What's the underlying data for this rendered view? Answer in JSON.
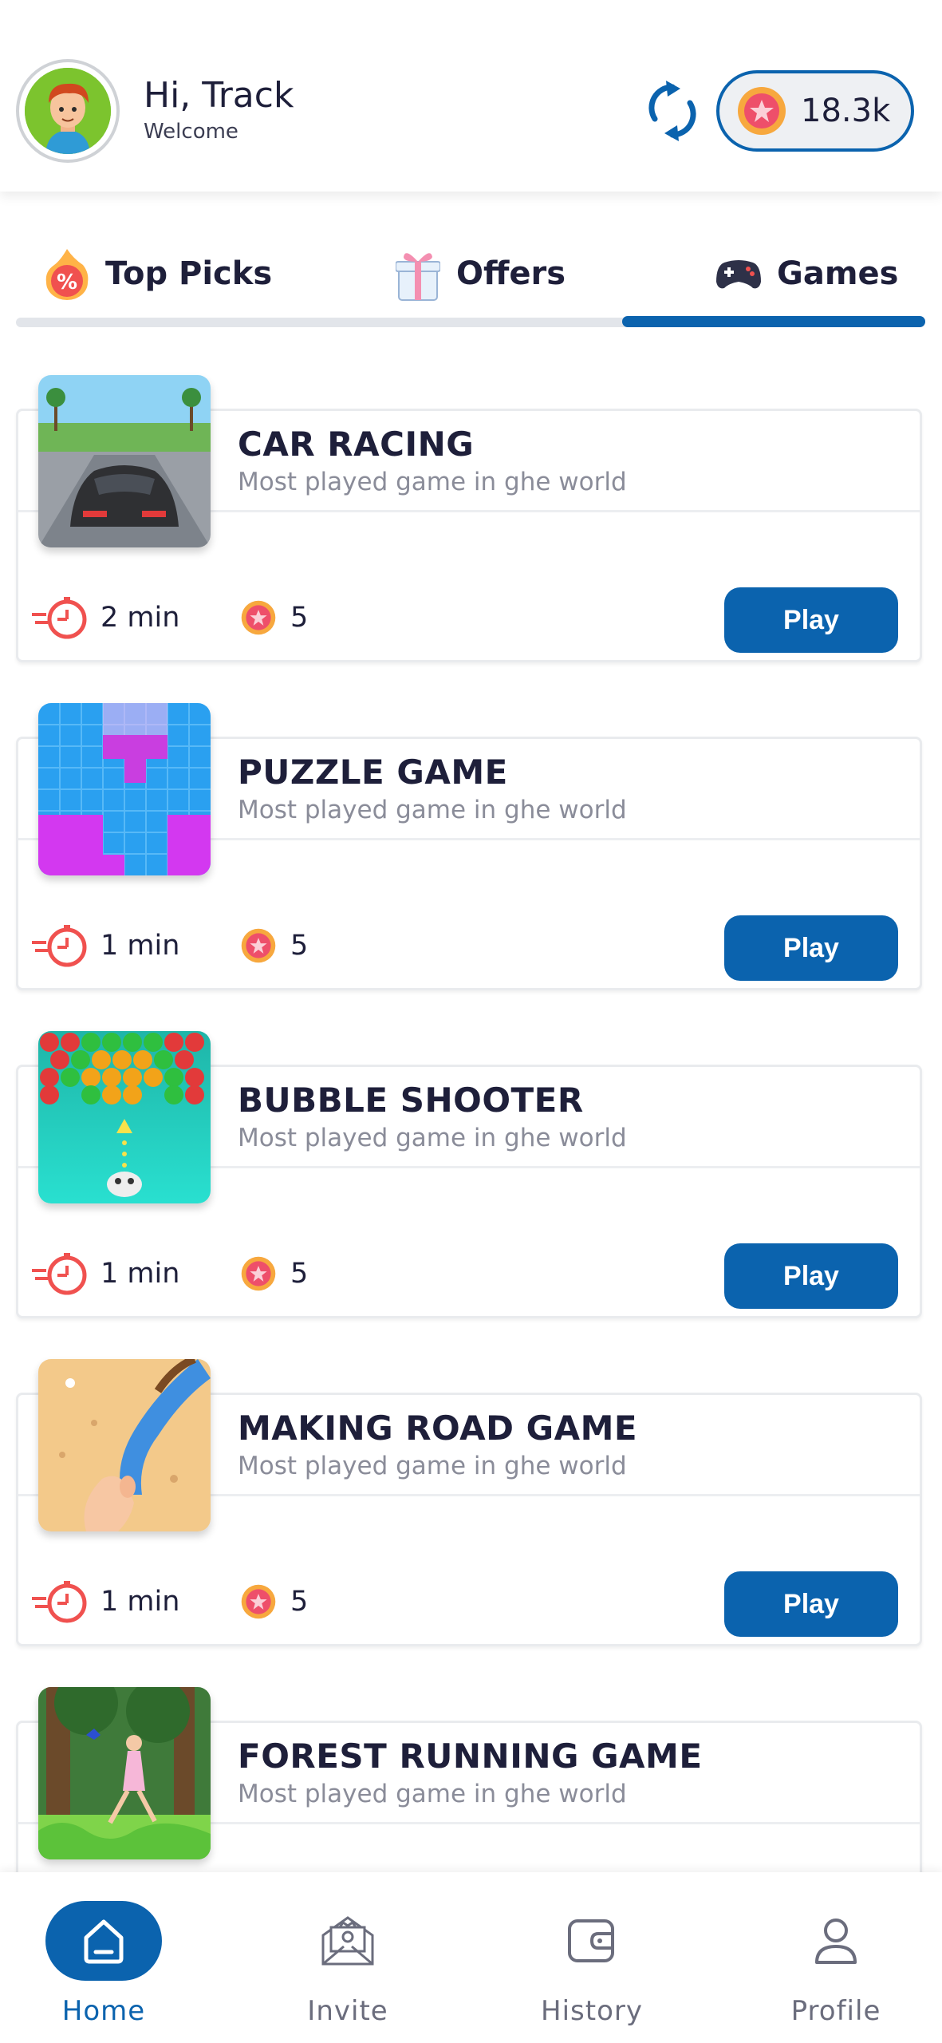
{
  "header": {
    "greeting_prefix": "Hi, ",
    "user_name": "Track",
    "subtitle": "Welcome",
    "coin_balance": "18.3k"
  },
  "tabs": [
    {
      "label": "Top Picks",
      "icon": "percent-flame-icon",
      "active": false
    },
    {
      "label": "Offers",
      "icon": "gift-icon",
      "active": false
    },
    {
      "label": "Games",
      "icon": "gamepad-icon",
      "active": true
    }
  ],
  "games": [
    {
      "title": "CAR RACING",
      "description": "Most played game in ghe world",
      "duration": "2 min",
      "coins": "5",
      "play_label": "Play",
      "thumb": "car-racing"
    },
    {
      "title": "PUZZLE GAME",
      "description": "Most played game in ghe world",
      "duration": "1 min",
      "coins": "5",
      "play_label": "Play",
      "thumb": "puzzle"
    },
    {
      "title": "BUBBLE SHOOTER",
      "description": "Most played game in ghe world",
      "duration": "1 min",
      "coins": "5",
      "play_label": "Play",
      "thumb": "bubble"
    },
    {
      "title": "MAKING ROAD GAME",
      "description": "Most played game in ghe world",
      "duration": "1 min",
      "coins": "5",
      "play_label": "Play",
      "thumb": "road"
    },
    {
      "title": "FOREST RUNNING GAME",
      "description": "Most played game in ghe world",
      "duration": "",
      "coins": "",
      "play_label": "",
      "thumb": "forest"
    }
  ],
  "bottom_nav": [
    {
      "label": "Home",
      "icon": "home-icon",
      "active": true
    },
    {
      "label": "Invite",
      "icon": "invite-envelope-icon",
      "active": false
    },
    {
      "label": "History",
      "icon": "wallet-icon",
      "active": false
    },
    {
      "label": "Profile",
      "icon": "user-icon",
      "active": false
    }
  ],
  "colors": {
    "primary": "#0b63ae",
    "text_dark": "#1e1f3a",
    "text_muted": "#8a8c99",
    "timer_red": "#f0514f",
    "coin_orange": "#f7a83e"
  }
}
